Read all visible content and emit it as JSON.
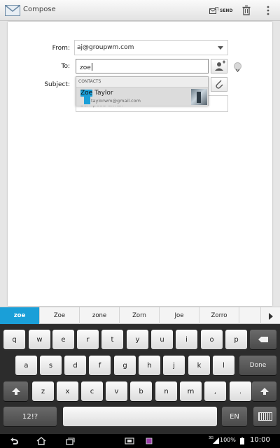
{
  "app": {
    "title": "Compose",
    "send_label": "SEND"
  },
  "form": {
    "from_label": "From:",
    "from_value": "aj@groupwm.com",
    "to_label": "To:",
    "to_value": "zoe",
    "subject_label": "Subject:",
    "body_placeholder": "Compose email"
  },
  "suggestions": {
    "header": "CONTACTS",
    "item": {
      "name_match": "Zoe",
      "name_rest": " Taylor",
      "email": "taylorwm@gmail.com"
    }
  },
  "word_suggestions": [
    "zoe",
    "Zoe",
    "zone",
    "Zorn",
    "Joe",
    "Zorro"
  ],
  "keyboard": {
    "row1": [
      "q",
      "w",
      "e",
      "r",
      "t",
      "y",
      "u",
      "i",
      "o",
      "p"
    ],
    "row2": [
      "a",
      "s",
      "d",
      "f",
      "g",
      "h",
      "j",
      "k",
      "l"
    ],
    "done_label": "Done",
    "row3": [
      "z",
      "x",
      "c",
      "v",
      "b",
      "n",
      "m",
      ",",
      "."
    ],
    "symbols_label": "12!?",
    "lang_label": "EN"
  },
  "status": {
    "network": "3G",
    "battery": "100%",
    "time": "10:00"
  },
  "colors": {
    "accent": "#1a9fd8"
  },
  "icons": [
    "email-app-icon",
    "send-icon",
    "trash-icon",
    "overflow-menu-icon",
    "add-contact-icon",
    "expand-icon",
    "attachment-icon",
    "backspace-icon",
    "shift-icon",
    "keyboard-hide-icon",
    "back-icon",
    "home-icon",
    "recents-icon",
    "screenshot-icon",
    "app-switch-icon",
    "battery-icon"
  ]
}
